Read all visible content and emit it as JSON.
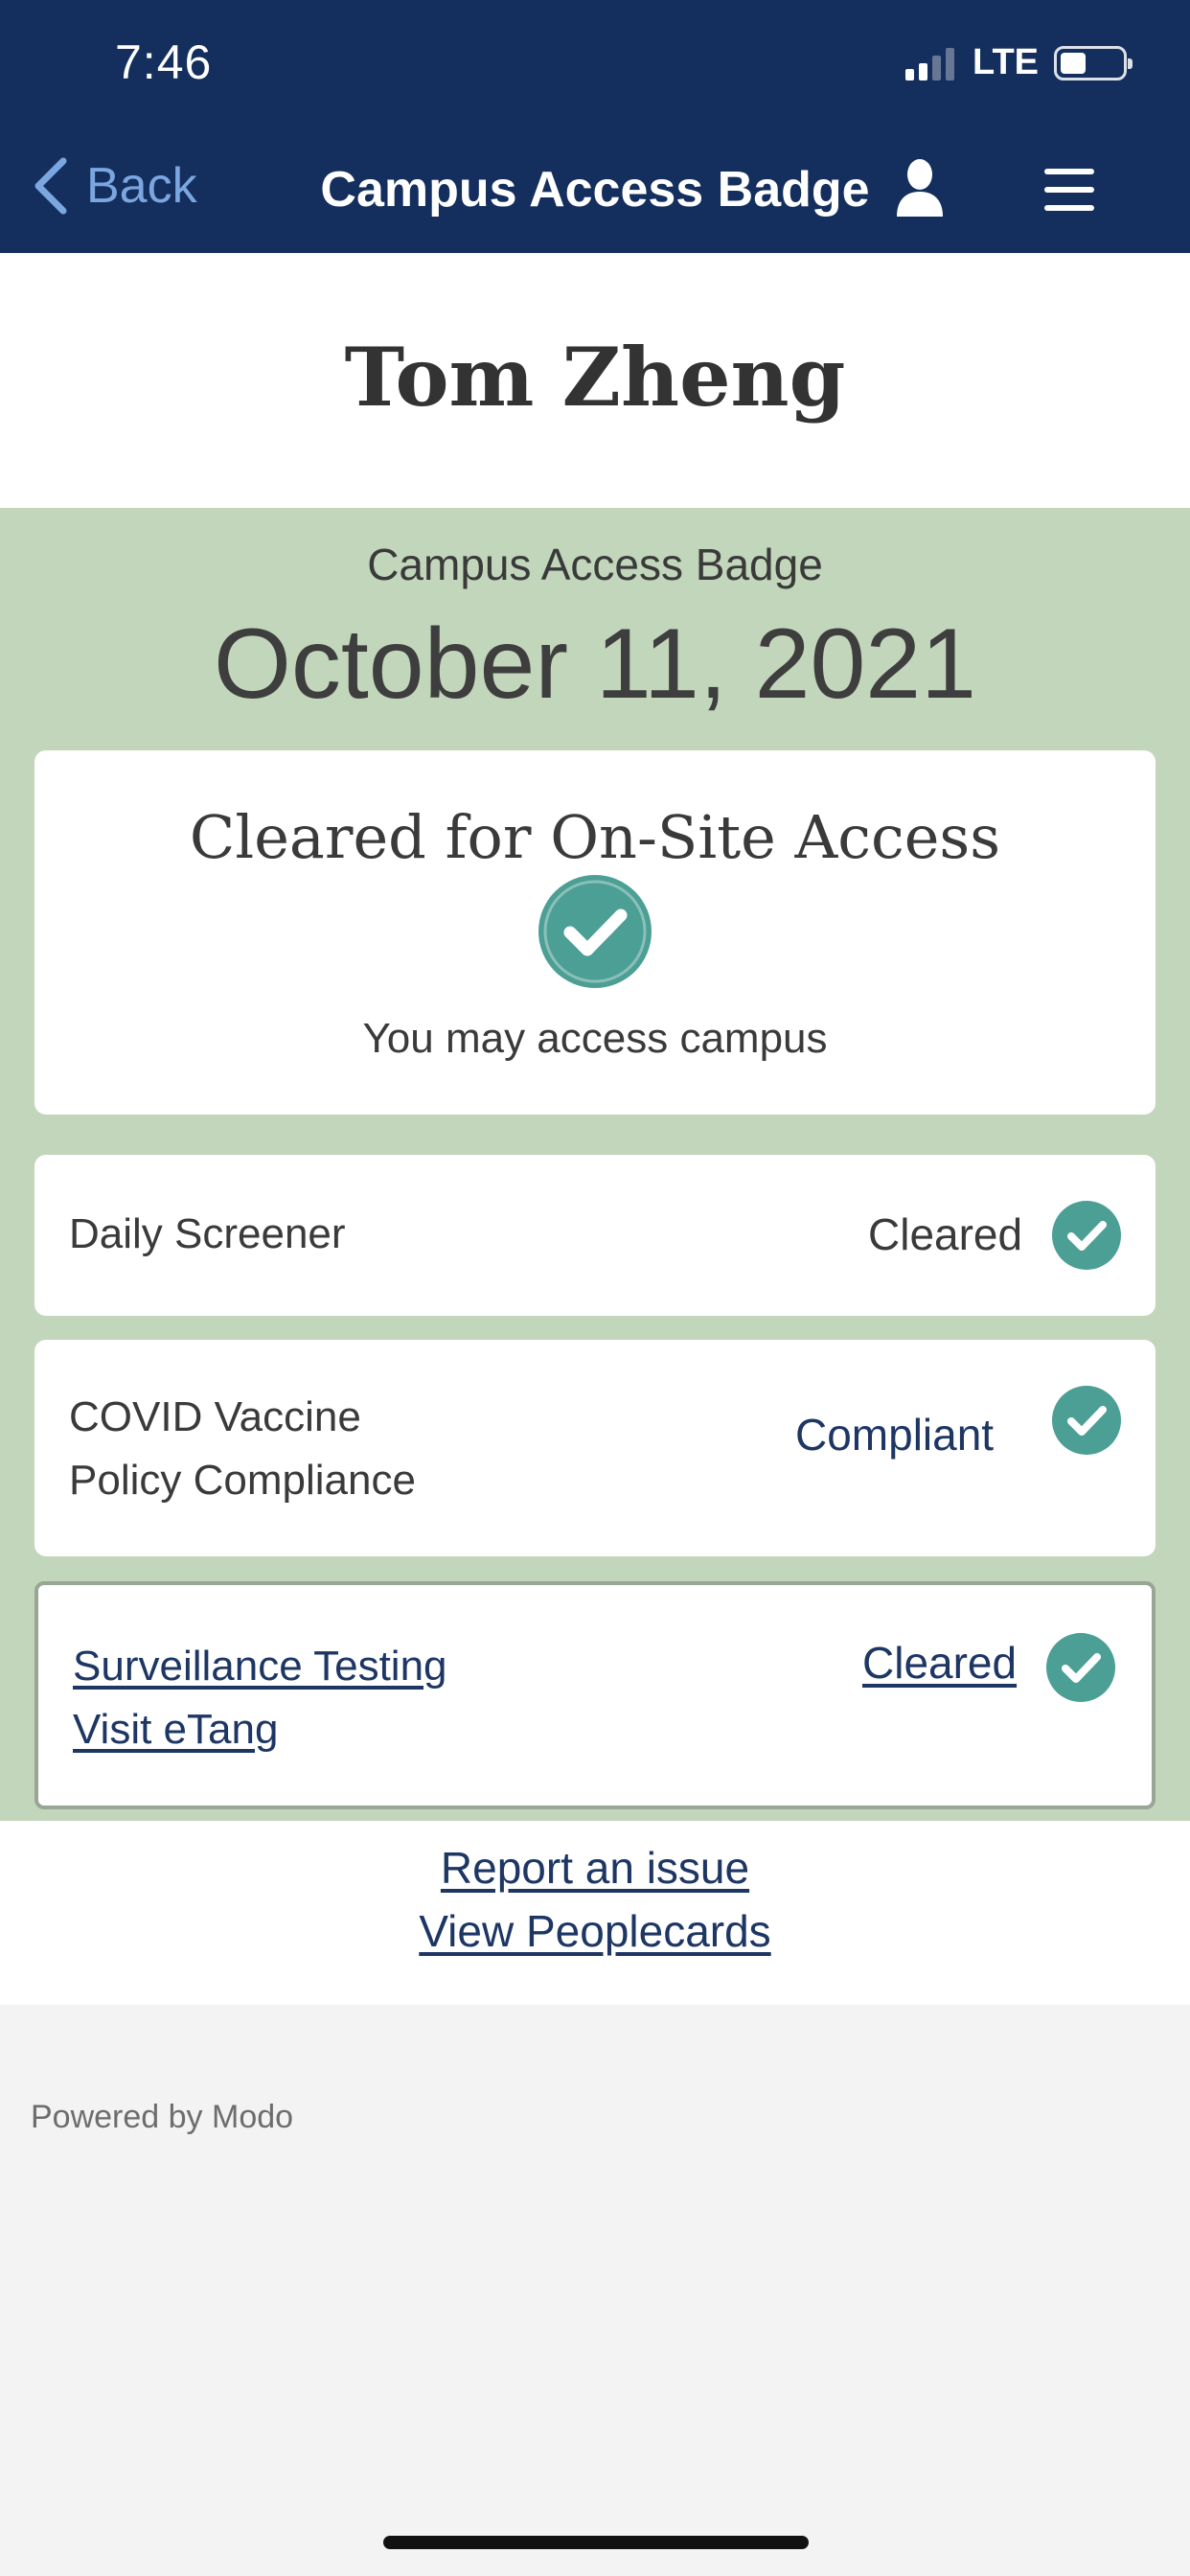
{
  "status_bar": {
    "time": "7:46",
    "network": "LTE",
    "battery_level": 0.4,
    "signal_bars": 2
  },
  "nav": {
    "back_label": "Back",
    "title": "Campus Access Badge"
  },
  "user": {
    "name": "Tom Zheng"
  },
  "badge": {
    "label": "Campus Access Badge",
    "date": "October 11, 2021",
    "status_heading": "Cleared for On-Site Access",
    "status_message": "You may access campus"
  },
  "checks": [
    {
      "label_line1": "Daily Screener",
      "label_line2": "",
      "value": "Cleared"
    },
    {
      "label_line1": "COVID Vaccine",
      "label_line2": "Policy Compliance",
      "value": "Compliant"
    },
    {
      "label_line1": "Surveillance Testing",
      "label_line2": "Visit eTang",
      "value": "Cleared"
    }
  ],
  "links": {
    "report": "Report an issue",
    "peoplecards": "View Peoplecards"
  },
  "footer": {
    "powered_by": "Powered by Modo"
  },
  "colors": {
    "header_bg": "#142f5d",
    "panel_green": "#c1d6ba",
    "check_teal": "#4c9f94",
    "link_blue": "#1d3664"
  }
}
